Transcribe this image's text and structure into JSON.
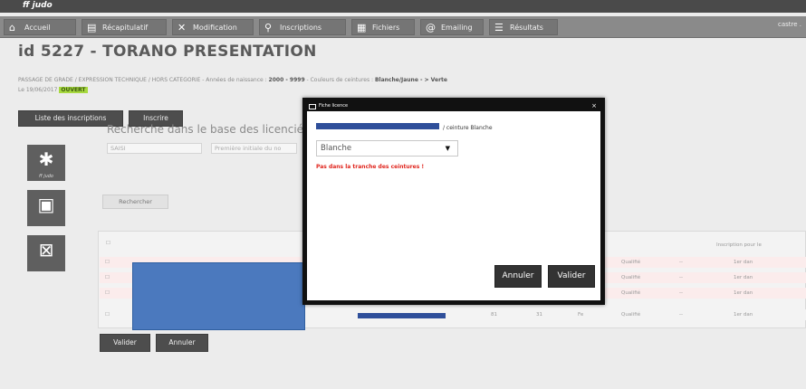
{
  "app": {
    "brand": "ff judo"
  },
  "nav": {
    "items": [
      {
        "label": "Accueil",
        "icon": "home-icon"
      },
      {
        "label": "Récapitulatif",
        "icon": "document-icon"
      },
      {
        "label": "Modification",
        "icon": "tools-icon"
      },
      {
        "label": "Inscriptions",
        "icon": "people-icon"
      },
      {
        "label": "Fichiers",
        "icon": "files-icon"
      },
      {
        "label": "Emailing",
        "icon": "at-icon"
      },
      {
        "label": "Résultats",
        "icon": "results-icon"
      }
    ],
    "user": "castre ."
  },
  "page": {
    "title": "id 5227 - TORANO PRESENTATION",
    "subtitle_prefix": "PASSAGE DE GRADE / EXPRESSION TECHNIQUE / HORS CATEGORIE - Années de naissance :",
    "birth_years": "2000 - 9999",
    "subtitle_mid": "- Couleurs de ceintures :",
    "belt_colors": "Blanche/Jaune - > Verte",
    "date": "Le 19/06/2017",
    "status": "OUVERT"
  },
  "actions": {
    "list_label": "Liste des inscriptions",
    "register_label": "Inscrire"
  },
  "tools": {
    "tiles": [
      {
        "icon": "judo-logo-icon",
        "caption": "ff judo"
      },
      {
        "icon": "photo-icon",
        "caption": ""
      },
      {
        "icon": "excel-icon",
        "caption": ""
      }
    ]
  },
  "search": {
    "title": "Recherche dans le base des licencié",
    "input1": "SAISI",
    "input2": "Première initiale du no",
    "button": "Rechercher"
  },
  "grid": {
    "rows": [
      {
        "col_a": "Qualifié",
        "col_b": "--",
        "col_c": "1er dan"
      },
      {
        "col_a": "Qualifié",
        "col_b": "--",
        "col_c": "1er dan"
      },
      {
        "col_a": "Qualifié",
        "col_b": "--",
        "col_c": "1er dan"
      },
      {
        "col_a": "Qualifié",
        "col_b": "--",
        "col_c": "1er dan"
      }
    ],
    "header_hint": "Inscription pour le",
    "row4_v1": "81",
    "row4_v2": "31",
    "row4_v3": "Fe"
  },
  "footer": {
    "validate_label": "Valider",
    "cancel_label": "Annuler"
  },
  "modal": {
    "title": "Fiche licence",
    "close": "×",
    "text": "/ ceinture Blanche",
    "select_value": "Blanche",
    "warning": "Pas dans la tranche des ceintures !",
    "cancel_label": "Annuler",
    "validate_label": "Valider"
  },
  "colors": {
    "modal_border": "#111111",
    "warning": "#e0261e",
    "redaction": "#4b79be",
    "status_badge": "#a7d93f"
  }
}
